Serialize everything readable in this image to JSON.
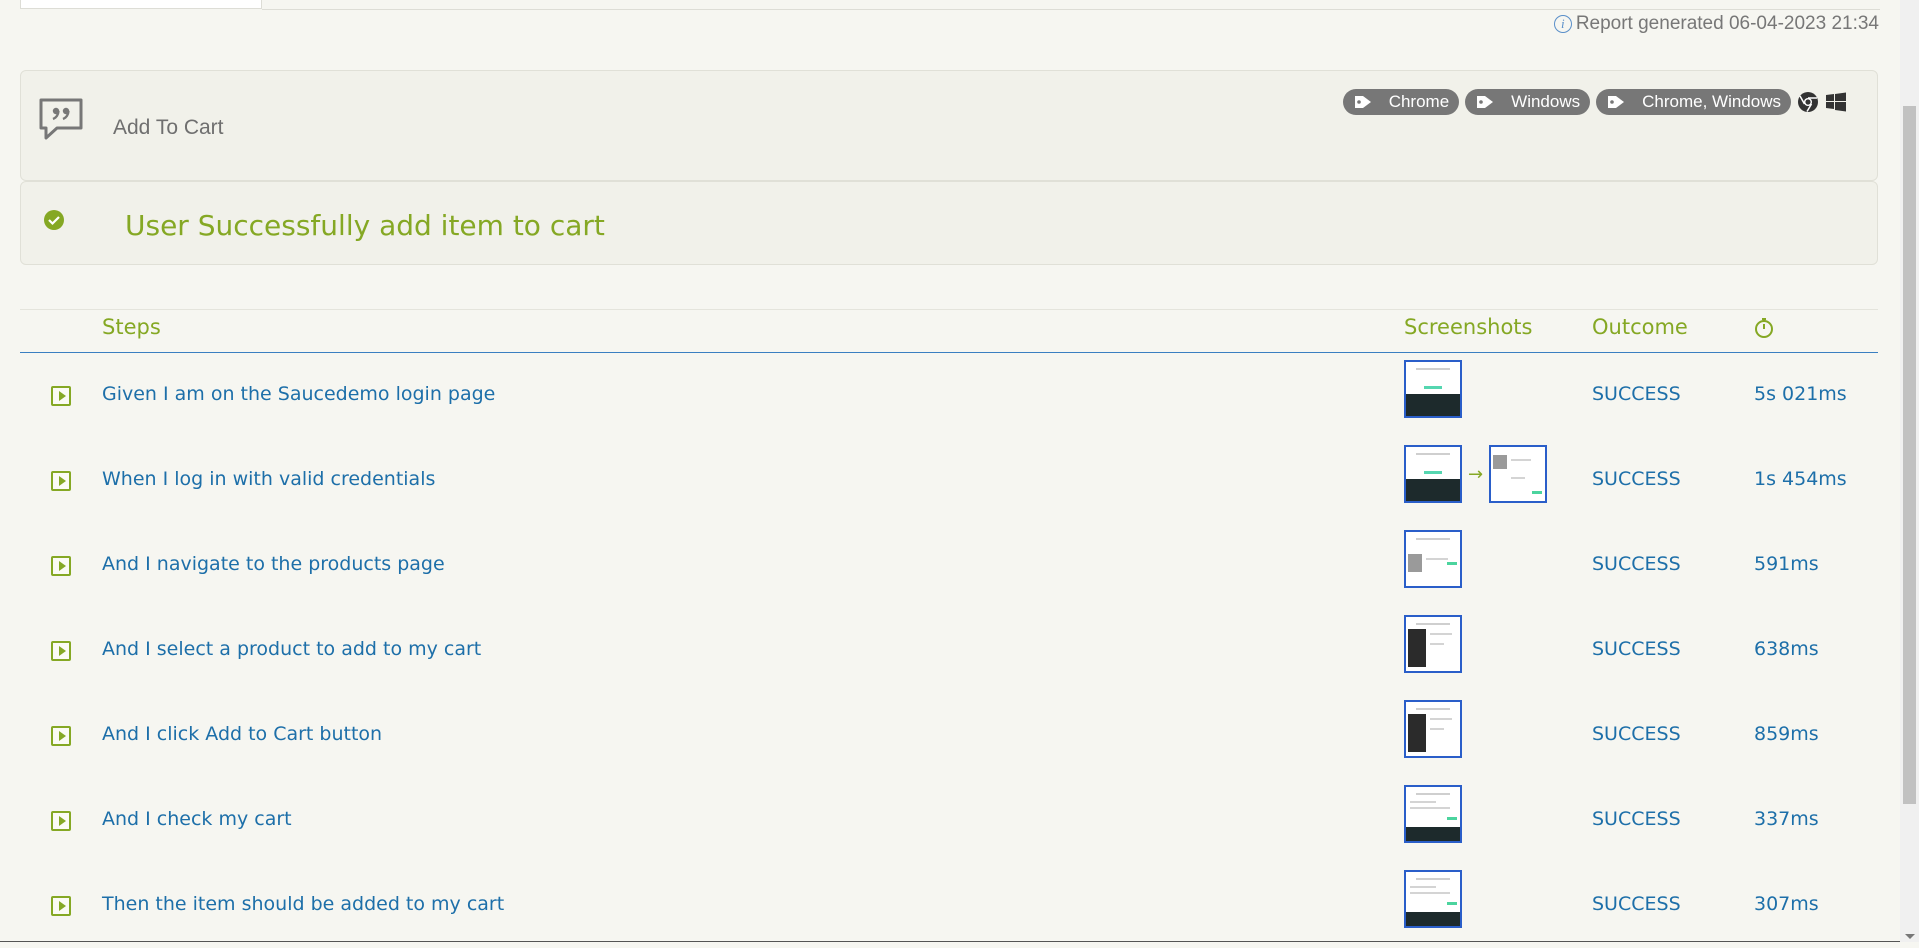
{
  "report": {
    "generated_label": "Report generated 06-04-2023 21:34"
  },
  "feature": {
    "title": "Add To Cart",
    "tags": [
      "Chrome",
      "Windows",
      "Chrome, Windows"
    ]
  },
  "scenario": {
    "title": "User Successfully add item to cart",
    "status": "success"
  },
  "table": {
    "headers": {
      "steps": "Steps",
      "screenshots": "Screenshots",
      "outcome": "Outcome",
      "duration_icon": "stopwatch-icon"
    },
    "rows": [
      {
        "step": "Given I am on the Saucedemo login page",
        "outcome": "SUCCESS",
        "duration": "5s 021ms",
        "screenshots": [
          "login"
        ]
      },
      {
        "step": "When I log in with valid credentials",
        "outcome": "SUCCESS",
        "duration": "1s 454ms",
        "screenshots": [
          "login",
          "products"
        ]
      },
      {
        "step": "And I navigate to the products page",
        "outcome": "SUCCESS",
        "duration": "591ms",
        "screenshots": [
          "products"
        ]
      },
      {
        "step": "And I select a product to add to my cart",
        "outcome": "SUCCESS",
        "duration": "638ms",
        "screenshots": [
          "product"
        ]
      },
      {
        "step": "And I click Add to Cart button",
        "outcome": "SUCCESS",
        "duration": "859ms",
        "screenshots": [
          "product"
        ]
      },
      {
        "step": "And I check my cart",
        "outcome": "SUCCESS",
        "duration": "337ms",
        "screenshots": [
          "cart"
        ]
      },
      {
        "step": "Then the item should be added to my cart",
        "outcome": "SUCCESS",
        "duration": "307ms",
        "screenshots": [
          "cart"
        ]
      }
    ]
  },
  "colors": {
    "accent_green": "#85a824",
    "link_blue": "#1d6fa9",
    "tag_gray": "#777777",
    "header_rule": "#3a7fc1"
  }
}
